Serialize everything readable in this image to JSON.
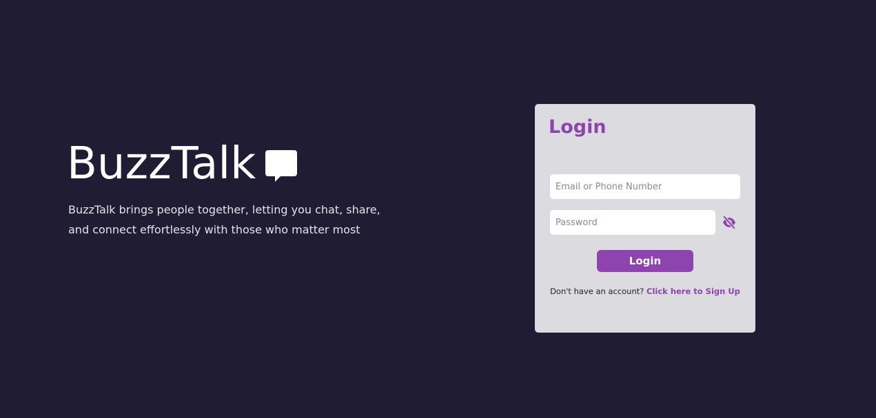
{
  "brand": {
    "name": "BuzzTalk",
    "icon": "chat-bubble-icon",
    "tagline": "BuzzTalk brings people together, letting you chat, share, and connect effortlessly with those who matter most"
  },
  "login": {
    "heading": "Login",
    "email_placeholder": "Email or Phone Number",
    "email_value": "",
    "password_placeholder": "Password",
    "password_value": "",
    "password_toggle_icon": "eye-slash-icon",
    "submit_label": "Login",
    "signup_prompt": "Don't have an account?",
    "signup_link": "Click here to Sign Up"
  },
  "colors": {
    "page_background": "#201c33",
    "card_background": "#dcdce0",
    "accent": "#8e44ad",
    "text_light": "#ffffff"
  }
}
